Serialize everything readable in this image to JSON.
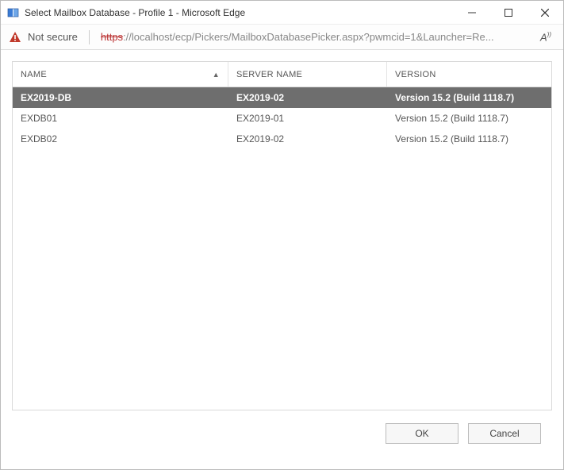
{
  "window": {
    "title": "Select Mailbox Database - Profile 1 - Microsoft Edge"
  },
  "addressbar": {
    "security_label": "Not secure",
    "url_scheme": "https",
    "url_rest": "://localhost/ecp/Pickers/MailboxDatabasePicker.aspx?pwmcid=1&Launcher=Re...",
    "reader_icon_label": "A))"
  },
  "grid": {
    "columns": {
      "name": "NAME",
      "server": "SERVER NAME",
      "version": "VERSION"
    },
    "sort_indicator": "▲",
    "rows": [
      {
        "name": "EX2019-DB",
        "server": "EX2019-02",
        "version": "Version 15.2 (Build 1118.7)",
        "selected": true
      },
      {
        "name": "EXDB01",
        "server": "EX2019-01",
        "version": "Version 15.2 (Build 1118.7)",
        "selected": false
      },
      {
        "name": "EXDB02",
        "server": "EX2019-02",
        "version": "Version 15.2 (Build 1118.7)",
        "selected": false
      }
    ]
  },
  "buttons": {
    "ok": "OK",
    "cancel": "Cancel"
  }
}
